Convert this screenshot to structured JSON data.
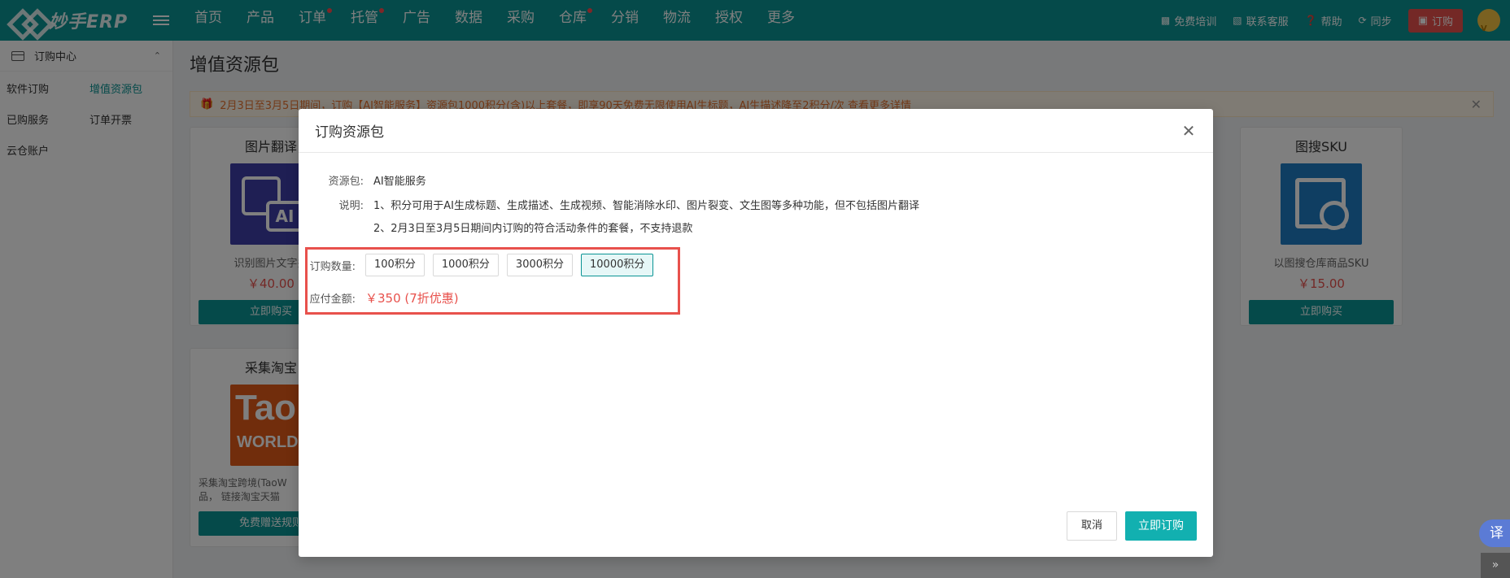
{
  "brand": {
    "logo_text": "妙手ERP"
  },
  "nav": {
    "items": [
      {
        "label": "首页",
        "dot": false
      },
      {
        "label": "产品",
        "dot": false
      },
      {
        "label": "订单",
        "dot": true
      },
      {
        "label": "托管",
        "dot": true
      },
      {
        "label": "广告",
        "dot": false
      },
      {
        "label": "数据",
        "dot": false
      },
      {
        "label": "采购",
        "dot": false
      },
      {
        "label": "仓库",
        "dot": true
      },
      {
        "label": "分销",
        "dot": false
      },
      {
        "label": "物流",
        "dot": false
      },
      {
        "label": "授权",
        "dot": false
      },
      {
        "label": "更多",
        "dot": false
      }
    ],
    "right": {
      "training": "免费培训",
      "support": "联系客服",
      "help": "帮助",
      "sync": "同步",
      "subscribe": "订购"
    }
  },
  "sidebar": {
    "header": "订购中心",
    "items": [
      {
        "label": "软件订购",
        "active": false
      },
      {
        "label": "增值资源包",
        "active": true
      },
      {
        "label": "已购服务",
        "active": false
      },
      {
        "label": "订单开票",
        "active": false
      },
      {
        "label": "云仓账户",
        "active": false
      }
    ]
  },
  "page": {
    "title": "增值资源包",
    "notice": "2月3日至3月5日期间，订购【AI智能服务】资源包1000积分(含)以上套餐，即享90天免费无限使用AI生标题，AI生描述降至2积分/次   查看更多详情",
    "cards": [
      {
        "title": "图片翻译",
        "desc": "识别图片文字并",
        "price": "￥40.00",
        "button": "立即购买"
      },
      {
        "title": "图搜SKU",
        "desc": "以图搜仓库商品SKU",
        "price": "￥15.00",
        "button": "立即购买"
      },
      {
        "title": "采集淘宝",
        "desc": "采集淘宝跨境(TaoW",
        "desc2": "品， 链接淘宝天猫",
        "logo_line1": "Tao",
        "logo_line2": "WORLD",
        "button": "免费赠送规则"
      }
    ]
  },
  "modal": {
    "title": "订购资源包",
    "package_label": "资源包:",
    "package_value": "AI智能服务",
    "desc_label": "说明:",
    "desc_line1": "1、积分可用于AI生成标题、生成描述、生成视频、智能消除水印、图片裂变、文生图等多种功能，但不包括图片翻译",
    "desc_line2": "2、2月3日至3月5日期间内订购的符合活动条件的套餐，不支持退款",
    "qty_label": "订购数量:",
    "qty_options": [
      "100积分",
      "1000积分",
      "3000积分",
      "10000积分"
    ],
    "qty_selected_index": 3,
    "amount_label": "应付金额:",
    "amount_value": "￥350 (7折优惠)",
    "cancel": "取消",
    "confirm": "立即订购"
  },
  "floating": {
    "translate": "译",
    "expand": "»"
  },
  "colors": {
    "primary": "#0a9494",
    "accent_red": "#e8514c",
    "confirm": "#12b0b0"
  }
}
